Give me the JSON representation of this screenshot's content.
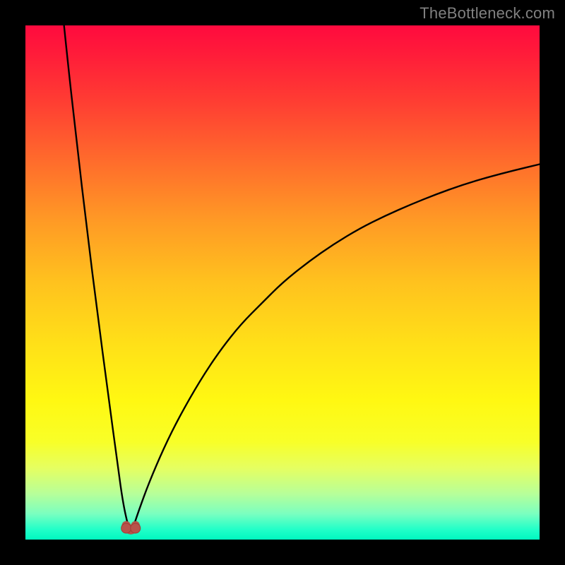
{
  "watermark": "TheBottleneck.com",
  "colors": {
    "frame": "#000000",
    "curve_stroke": "#000000",
    "marker_fill": "#b8524a",
    "marker_stroke": "#9e3d36",
    "watermark": "#808080",
    "gradient_top": "#ff0a3e",
    "gradient_bottom": "#00f8c0"
  },
  "chart_data": {
    "type": "line",
    "title": "",
    "xlabel": "",
    "ylabel": "",
    "xlim": [
      0,
      100
    ],
    "ylim": [
      0,
      100
    ],
    "grid": false,
    "note": "V-shaped bottleneck curve. Minimum (≈0% bottleneck) at x≈20.5. Left branch climbs steeply past y=100 near x≈6. Right branch rises with decreasing slope toward ~73 at x=100. Values beyond y=100 are clipped by the plot area.",
    "series": [
      {
        "name": "bottleneck-curve",
        "x": [
          6,
          8,
          10,
          12,
          14,
          16,
          18,
          19,
          20,
          20.5,
          21,
          22,
          24,
          27,
          30,
          34,
          38,
          42,
          46,
          50,
          55,
          60,
          65,
          70,
          75,
          80,
          85,
          90,
          95,
          100
        ],
        "values": [
          115,
          95,
          77,
          60,
          44,
          29,
          14,
          7,
          2.5,
          1.5,
          2.5,
          5.5,
          11,
          18,
          24,
          31,
          37,
          42,
          46,
          50,
          54,
          57.5,
          60.5,
          63,
          65.2,
          67.2,
          69,
          70.5,
          71.8,
          73
        ]
      }
    ],
    "markers": [
      {
        "name": "min-left",
        "x": 19.6,
        "y": 2.2
      },
      {
        "name": "min-right",
        "x": 21.4,
        "y": 2.2
      }
    ],
    "background_gradient_meaning": "green (bottom) = low bottleneck / good; red (top) = high bottleneck / bad"
  }
}
